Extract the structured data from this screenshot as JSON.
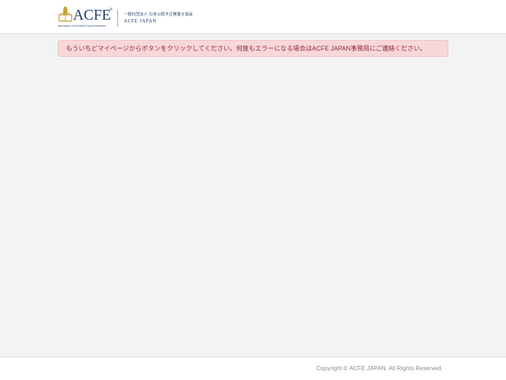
{
  "header": {
    "logo": {
      "wordmark": "ACFE",
      "registered_mark": "®",
      "tagline": "Association of Certified Fraud Examiners",
      "org_name_jp": "一般社団法人 日本公認不正検査士協会",
      "org_name_en": "ACFE JAPAN",
      "brand_color": "#1f3f6b",
      "emblem_color": "#c8a23a"
    }
  },
  "alert": {
    "message": "もういちどマイページからボタンをクリックしてください。何度もエラーになる場合はACFE JAPAN事務局にご連絡ください。",
    "background_color": "#f8d7da",
    "text_color": "#8a2d35"
  },
  "footer": {
    "copyright": "Copyright © ACFE JAPAN. All Rights Reserved."
  }
}
